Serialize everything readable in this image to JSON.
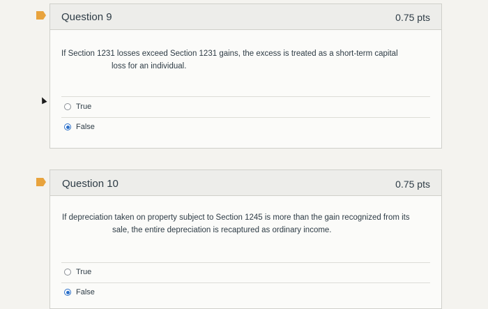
{
  "questions": [
    {
      "title": "Question 9",
      "points": "0.75 pts",
      "text_line1": "If Section 1231 losses exceed Section 1231 gains, the excess is treated as a short-term capital",
      "text_line2": "loss for an individual.",
      "options": [
        {
          "label": "True",
          "selected": false
        },
        {
          "label": "False",
          "selected": true
        }
      ]
    },
    {
      "title": "Question 10",
      "points": "0.75 pts",
      "text_line1": "If depreciation taken on property subject to Section 1245 is more than the gain recognized from its",
      "text_line2": "sale, the entire depreciation is recaptured as ordinary income.",
      "options": [
        {
          "label": "True",
          "selected": false
        },
        {
          "label": "False",
          "selected": true
        }
      ]
    }
  ],
  "colors": {
    "flag": "#e8a33d",
    "selected_radio": "#2a6fc9"
  }
}
